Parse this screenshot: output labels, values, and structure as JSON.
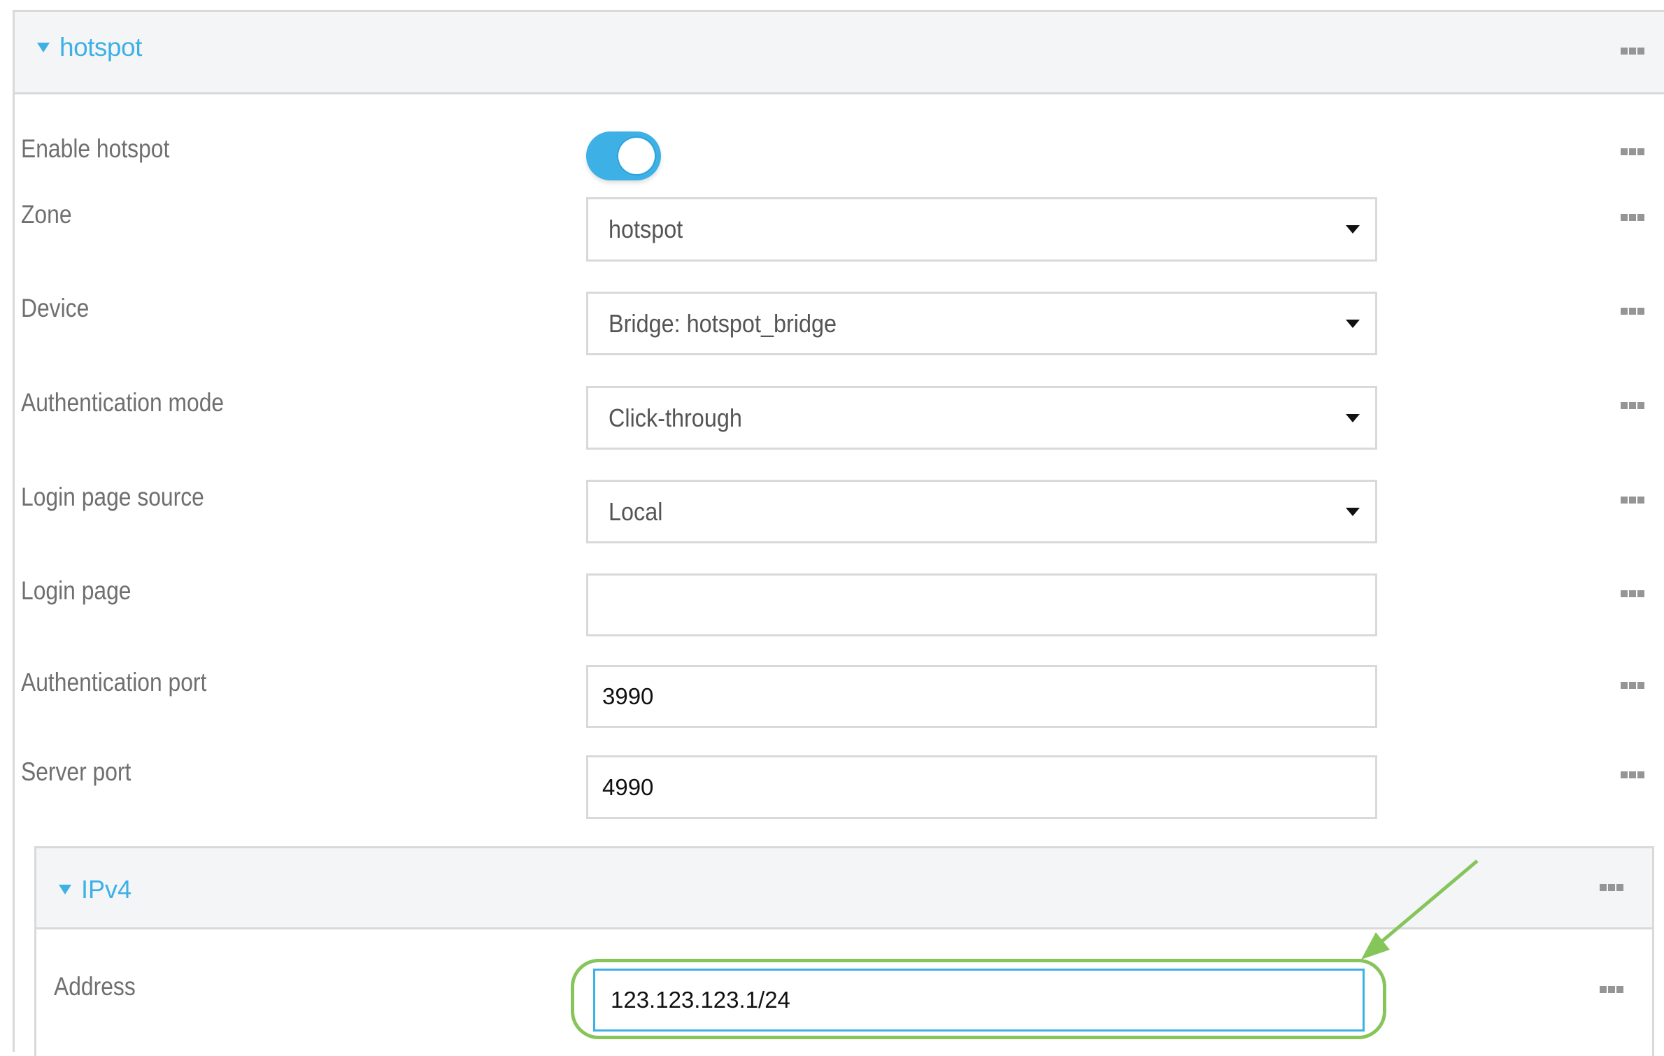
{
  "section": {
    "title": "hotspot",
    "expanded": true
  },
  "fields": [
    {
      "label": "Enable hotspot",
      "type": "toggle",
      "value": true
    },
    {
      "label": "Zone",
      "type": "select",
      "value": "hotspot"
    },
    {
      "label": "Device",
      "type": "select",
      "value": "Bridge: hotspot_bridge"
    },
    {
      "label": "Authentication mode",
      "type": "select",
      "value": "Click-through"
    },
    {
      "label": "Login page source",
      "type": "select",
      "value": "Local"
    },
    {
      "label": "Login page",
      "type": "text",
      "value": ""
    },
    {
      "label": "Authentication port",
      "type": "text",
      "value": "3990"
    },
    {
      "label": "Server port",
      "type": "text",
      "value": "4990"
    }
  ],
  "ipv4": {
    "title": "IPv4",
    "expanded": true,
    "address_label": "Address",
    "address_value": "123.123.123.1/24"
  },
  "icons": {
    "more": "more-options-icon",
    "collapse": "caret-down-icon",
    "dropdown": "dropdown-arrow-icon"
  },
  "colors": {
    "accent": "#3db0e6",
    "annotation": "#86c55a",
    "header_bg": "#f4f5f7",
    "border": "#d9d9d9"
  }
}
